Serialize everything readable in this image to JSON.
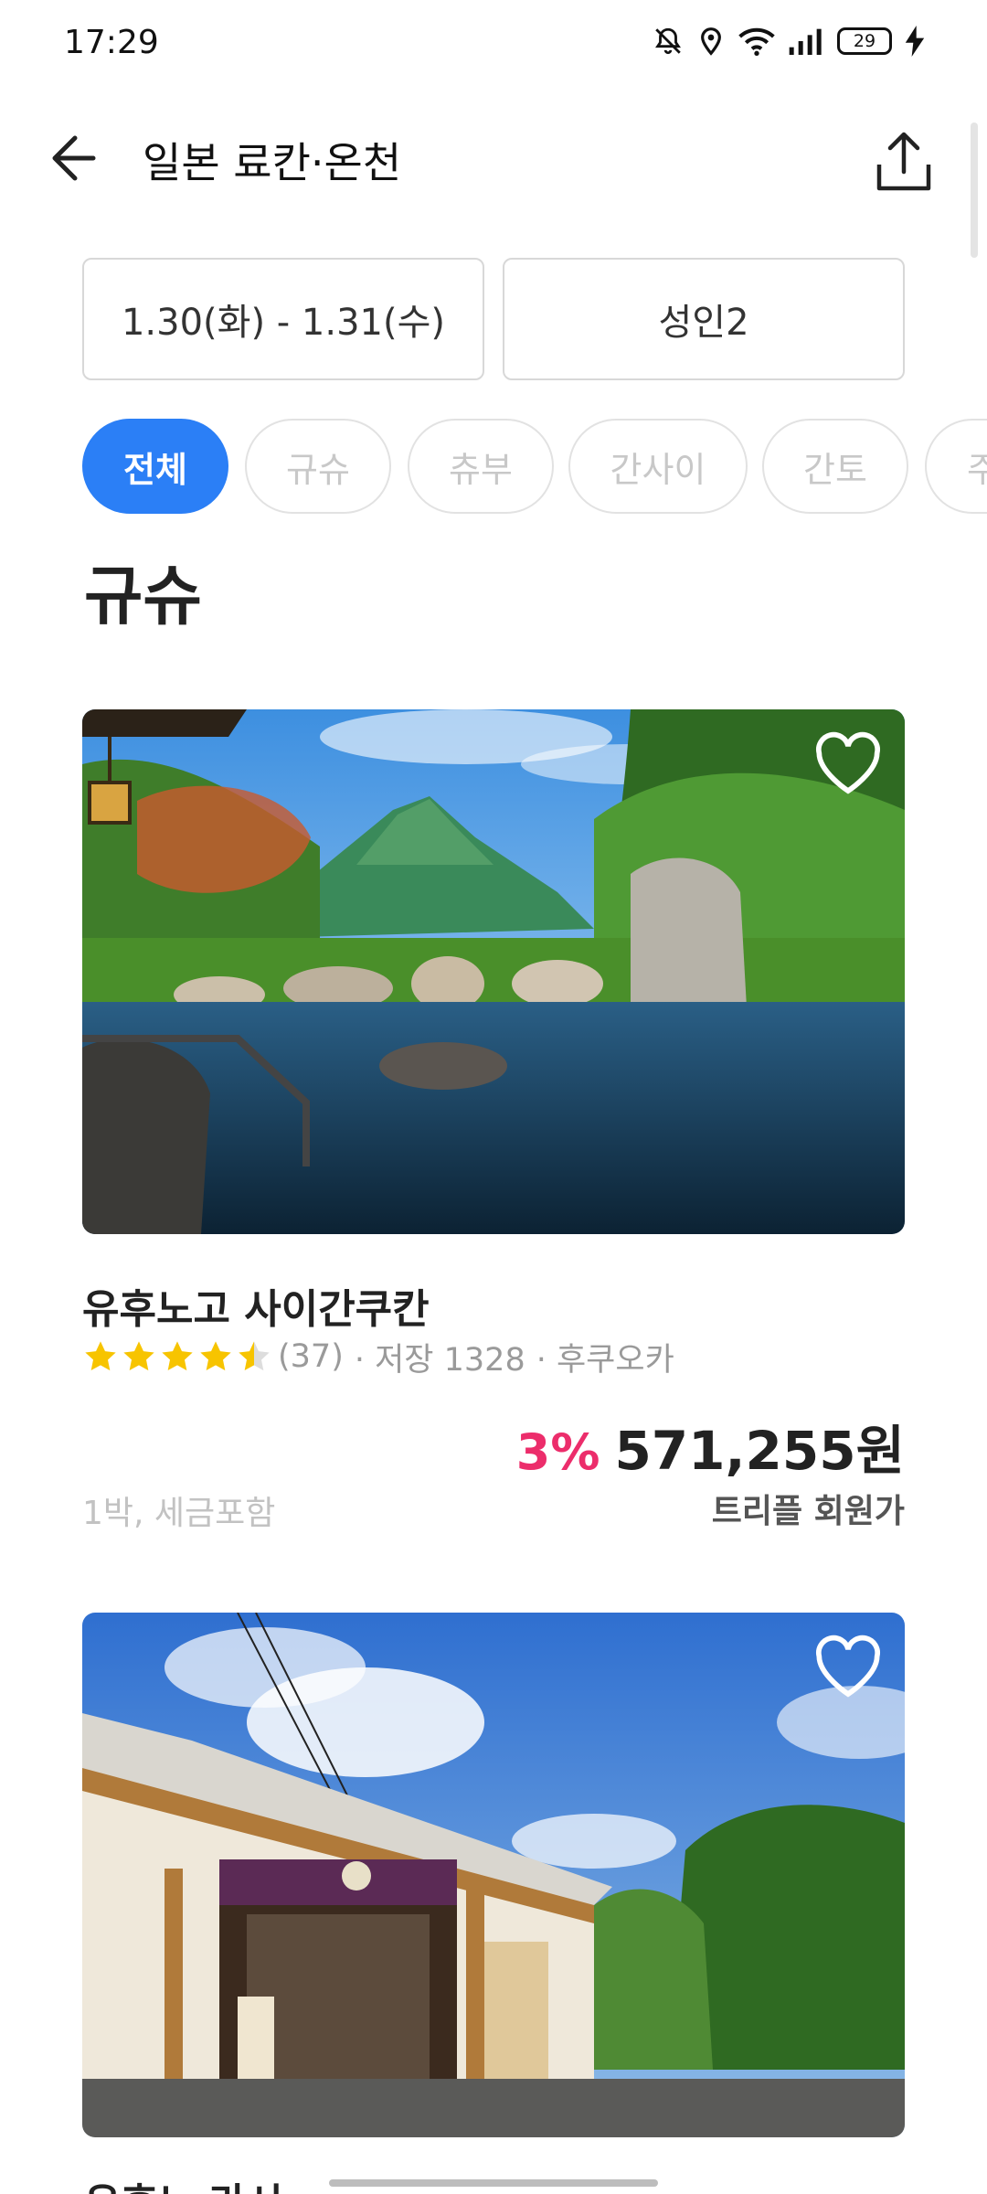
{
  "status_bar": {
    "time": "17:29",
    "battery_level": "29",
    "icons": [
      "bell-off-icon",
      "location-icon",
      "wifi-icon",
      "signal-icon",
      "battery-icon",
      "charging-icon"
    ]
  },
  "header": {
    "title": "일본 료칸·온천",
    "back_icon": "arrow-left-icon",
    "share_icon": "share-icon"
  },
  "filters": {
    "dates": "1.30(화) - 1.31(수)",
    "guests": "성인2"
  },
  "tabs": [
    {
      "label": "전체",
      "active": true
    },
    {
      "label": "규슈",
      "active": false
    },
    {
      "label": "츄부",
      "active": false
    },
    {
      "label": "간사이",
      "active": false
    },
    {
      "label": "간토",
      "active": false
    },
    {
      "label": "주",
      "active": false
    }
  ],
  "section": {
    "title": "규슈"
  },
  "listings": [
    {
      "name": "유후노고 사이간쿠칸",
      "rating": 4.5,
      "reviews": "(37)",
      "saves": "· 저장 1328",
      "location": "· 후쿠오카",
      "discount": "3%",
      "price": "571,255원",
      "nights": "1박, 세금포함",
      "price_label": "트리플 회원가",
      "image": "outdoor hot spring with mountain"
    },
    {
      "name": "유후노 라시",
      "image": "traditional inn entrance"
    }
  ],
  "colors": {
    "accent": "#2b7ff6",
    "discount": "#ec2d6b",
    "star": "#f7c400"
  }
}
